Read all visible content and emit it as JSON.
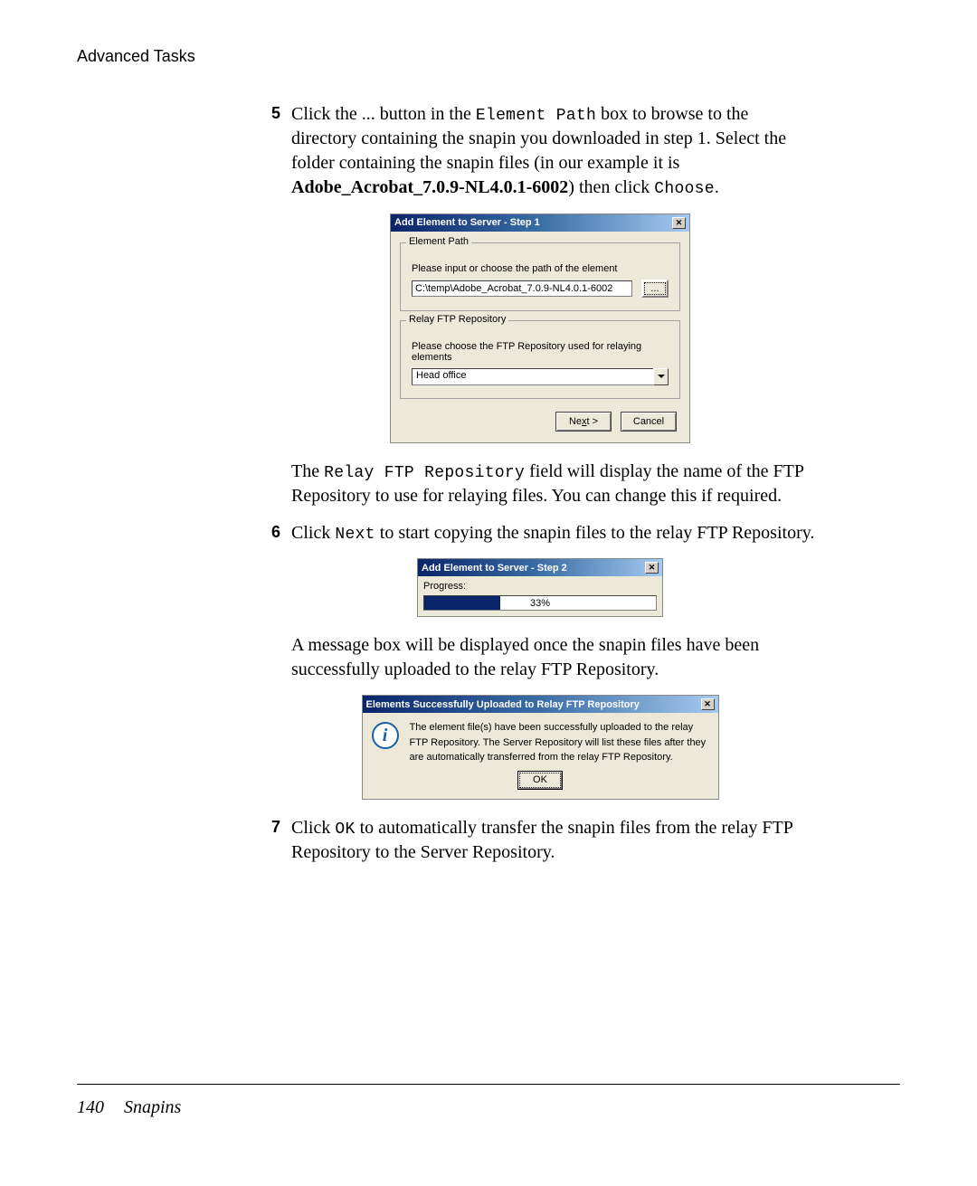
{
  "header": "Advanced Tasks",
  "steps": {
    "s5": {
      "num": "5",
      "t1": "Click the ",
      "t2": "...",
      "t3": " button in the ",
      "t4": "Element Path",
      "t5": " box to browse to the directory containing the snapin you downloaded in step 1. Select the folder containing the snapin files (in our example it is ",
      "t6": "Adobe_Acrobat_7.0.9-NL4.0.1-6002",
      "t7": ") then click ",
      "t8": "Choose",
      "t9": "."
    },
    "s5b": {
      "t1": "The ",
      "t2": "Relay FTP Repository",
      "t3": " field will display the name of the FTP Repository to use for relaying files. You can change this if required."
    },
    "s6": {
      "num": "6",
      "t1": "Click ",
      "t2": "Next",
      "t3": " to start copying the snapin files to the relay FTP Repository."
    },
    "s6b": "A message box will be displayed once the snapin files have been successfully uploaded to the relay FTP Repository.",
    "s7": {
      "num": "7",
      "t1": "Click ",
      "t2": "OK",
      "t3": " to automatically transfer the snapin files from the relay FTP Repository to the Server Repository."
    }
  },
  "dialog1": {
    "title": "Add Element to Server - Step 1",
    "legend1": "Element Path",
    "label1": "Please input or choose the path of the element",
    "path": "C:\\temp\\Adobe_Acrobat_7.0.9-NL4.0.1-6002",
    "browse": "...",
    "legend2": "Relay FTP Repository",
    "label2": "Please choose the FTP Repository used for relaying elements",
    "selected": "Head office",
    "next_pre": "Ne",
    "next_u": "x",
    "next_post": "t >",
    "cancel": "Cancel"
  },
  "dialog2": {
    "title": "Add Element to Server - Step 2",
    "progress_label": "Progress:",
    "progress_pct": "33%"
  },
  "dialog3": {
    "title": "Elements Successfully Uploaded to Relay FTP Repository",
    "msg": "The element file(s) have been successfully uploaded to the relay FTP Repository. The Server Repository will list these files after they are automatically transferred from the relay FTP Repository.",
    "ok": "OK"
  },
  "footer": {
    "page": "140",
    "section": "Snapins"
  }
}
